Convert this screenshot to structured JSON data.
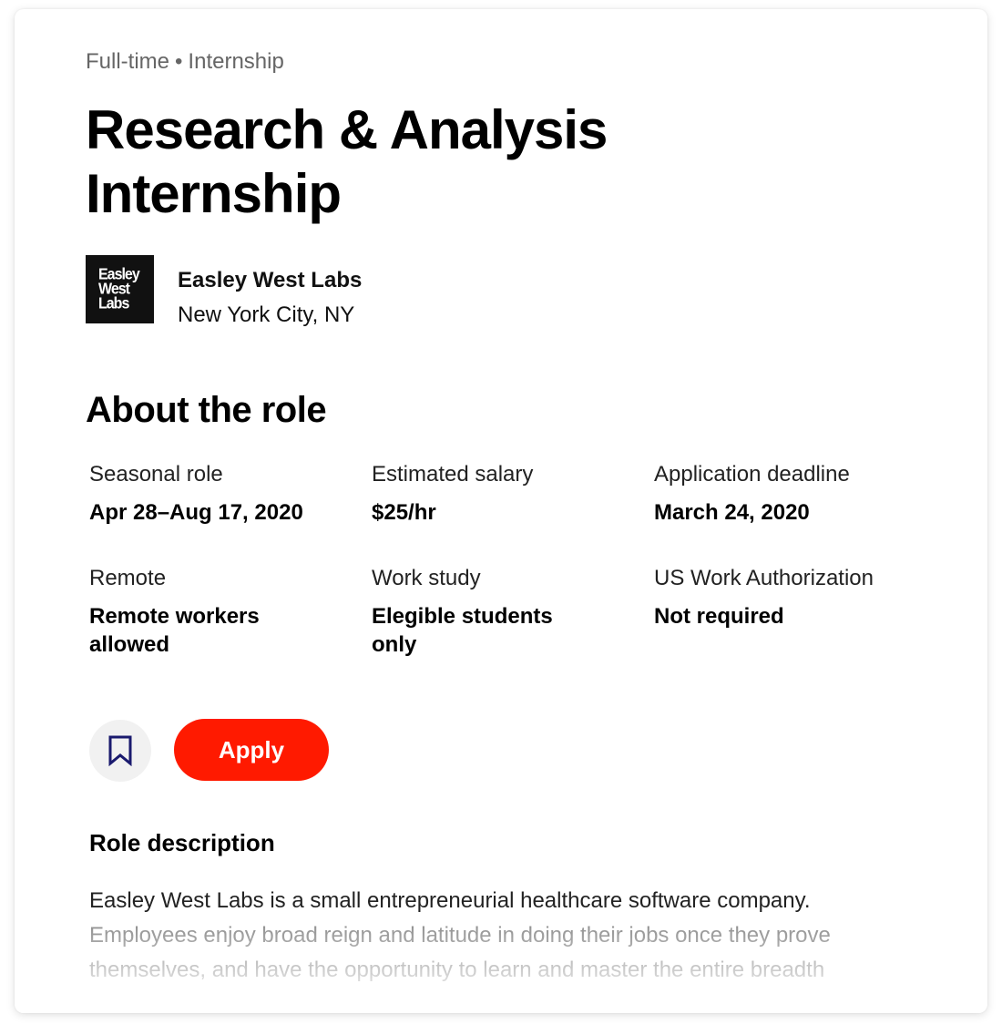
{
  "job": {
    "type": "Full-time",
    "separator": "•",
    "category": "Internship",
    "title": "Research & Analysis Internship"
  },
  "company": {
    "logo_lines": [
      "Easley",
      "West",
      "Labs"
    ],
    "name": "Easley West Labs",
    "location": "New York City, NY"
  },
  "about": {
    "heading": "About the role",
    "details": [
      {
        "label": "Seasonal role",
        "value": "Apr 28–Aug 17, 2020"
      },
      {
        "label": "Estimated salary",
        "value": "$25/hr"
      },
      {
        "label": "Application deadline",
        "value": "March 24, 2020"
      },
      {
        "label": "Remote",
        "value": "Remote workers allowed"
      },
      {
        "label": "Work study",
        "value": "Elegible students only"
      },
      {
        "label": "US Work Authorization",
        "value": "Not required"
      }
    ]
  },
  "actions": {
    "bookmark_icon": "bookmark-icon",
    "apply_label": "Apply"
  },
  "description": {
    "heading": "Role description",
    "text": "Easley West Labs is a small entrepreneurial healthcare software company. Employees enjoy broad reign and latitude in doing their jobs once they prove themselves, and have the opportunity to learn and master the entire breadth"
  },
  "colors": {
    "accent": "#ff1a00",
    "bookmark_icon": "#1a1a6e",
    "logo_bg": "#111111"
  }
}
